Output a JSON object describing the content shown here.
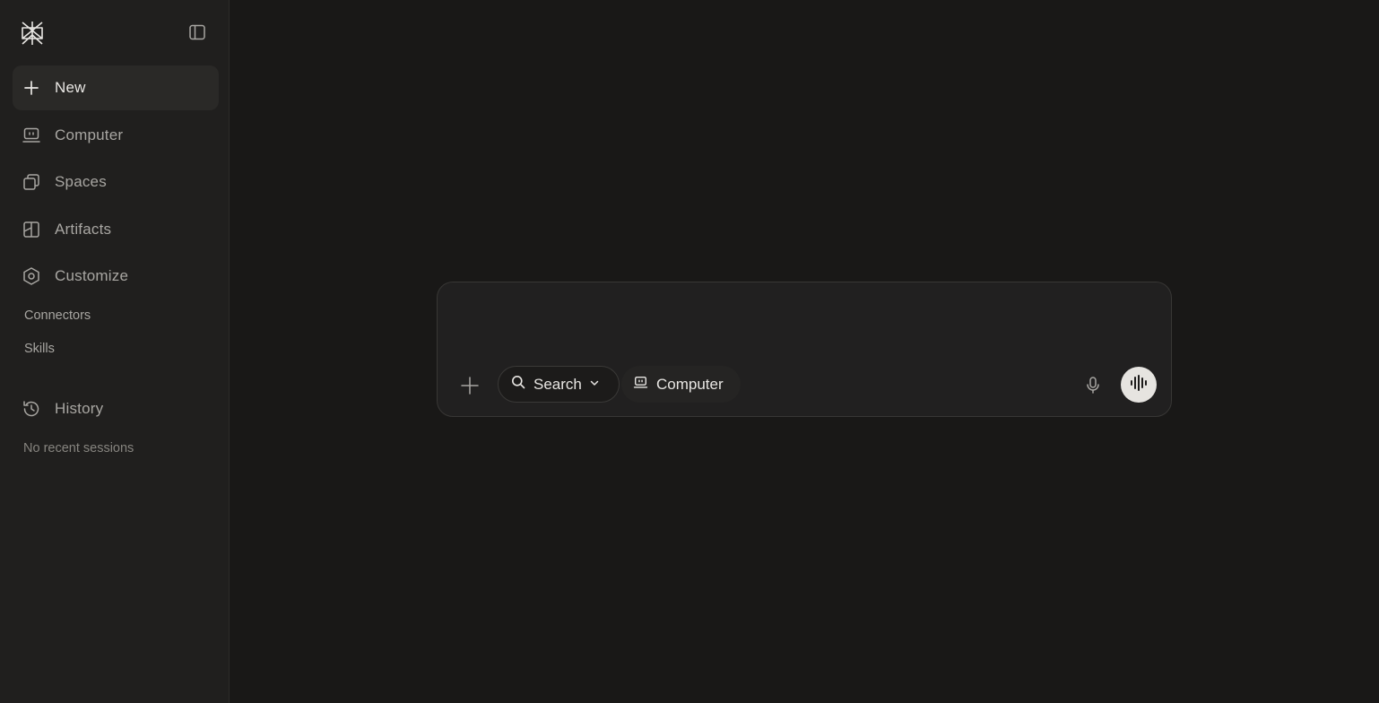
{
  "sidebar": {
    "logo_icon": "perplexity-logo-icon",
    "toggle_icon": "sidebar-toggle-icon",
    "nav": [
      {
        "label": "New",
        "icon": "plus-icon",
        "active": true
      },
      {
        "label": "Computer",
        "icon": "computer-icon"
      },
      {
        "label": "Spaces",
        "icon": "spaces-icon"
      },
      {
        "label": "Artifacts",
        "icon": "artifacts-icon"
      },
      {
        "label": "Customize",
        "icon": "customize-icon"
      }
    ],
    "sub_items": [
      {
        "label": "Connectors"
      },
      {
        "label": "Skills"
      }
    ],
    "history": {
      "label": "History",
      "icon": "history-icon"
    },
    "empty_note": "No recent sessions"
  },
  "composer": {
    "attach_icon": "plus-icon",
    "search_mode": {
      "label": "Search",
      "icon": "search-icon",
      "dropdown_icon": "chevron-down-icon"
    },
    "computer_mode": {
      "label": "Computer",
      "icon": "computer-icon"
    },
    "mic_icon": "microphone-icon",
    "voice_icon": "voice-waveform-icon"
  },
  "colors": {
    "background": "#191817",
    "sidebar": "#201f1e",
    "text": "#e8e6e3",
    "muted": "#a8a6a2",
    "voice_button": "#e6e4e0"
  }
}
